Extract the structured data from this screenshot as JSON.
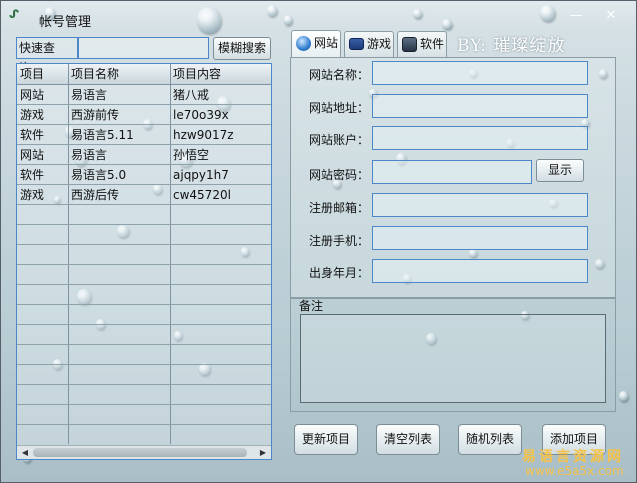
{
  "window": {
    "title": "帐号管理",
    "icon": "app-icon",
    "buttons": [
      "minimize",
      "close"
    ]
  },
  "search": {
    "label": "快速查询：",
    "value": "",
    "button_label": "模糊搜索"
  },
  "table": {
    "columns": [
      "项目",
      "项目名称",
      "项目内容"
    ],
    "rows": [
      [
        "网站",
        "易语言",
        "猪八戒"
      ],
      [
        "游戏",
        "西游前传",
        "le70o39x"
      ],
      [
        "软件",
        "易语言5.11",
        "hzw9017z"
      ],
      [
        "网站",
        "易语言",
        "孙悟空"
      ],
      [
        "软件",
        "易语言5.0",
        "ajqpy1h7"
      ],
      [
        "游戏",
        "西游后传",
        "cw45720l"
      ]
    ]
  },
  "tabs": [
    {
      "label": "网站",
      "icon": "globe-icon",
      "active": true
    },
    {
      "label": "游戏",
      "icon": "game-icon",
      "active": false
    },
    {
      "label": "软件",
      "icon": "software-icon",
      "active": false
    }
  ],
  "author": "BY: 璀璨绽放",
  "form": {
    "site_name_label": "网站名称：",
    "site_url_label": "网站地址：",
    "account_label": "网站账户：",
    "password_label": "网站密码：",
    "show_label": "显示",
    "email_label": "注册邮箱：",
    "phone_label": "注册手机：",
    "birth_label": "出身年月："
  },
  "memo": {
    "label": "备注",
    "value": ""
  },
  "actions": {
    "update": "更新项目",
    "clear": "清空列表",
    "random": "随机列表",
    "add": "添加项目"
  },
  "watermark": {
    "name": "易语言资源网",
    "url": "www.e5a5x.com"
  },
  "colors": {
    "border_blue": "#4c88c8",
    "watermark_gold": "#f5c24a"
  }
}
